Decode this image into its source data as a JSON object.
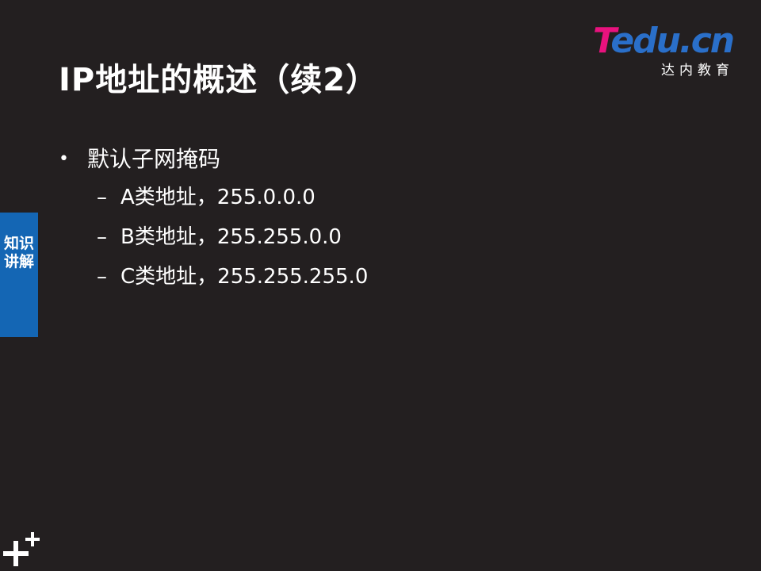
{
  "slide": {
    "title": "IP地址的概述（续2）",
    "logo": {
      "brand_t": "T",
      "brand_rest": "edu.cn",
      "subtitle": "达内教育"
    },
    "bullets": [
      {
        "text": "默认子网掩码",
        "children": [
          "A类地址，255.0.0.0",
          "B类地址，255.255.0.0",
          "C类地址，255.255.255.0"
        ]
      }
    ],
    "bullet_symbol": "•",
    "sub_bullet_symbol": "–",
    "side_tab": "知识讲解",
    "colors": {
      "background": "#231f20",
      "side_tab": "#1466b4",
      "logo_pink": "#e8127e",
      "logo_blue": "#2a6fc9",
      "text": "#ffffff"
    }
  }
}
